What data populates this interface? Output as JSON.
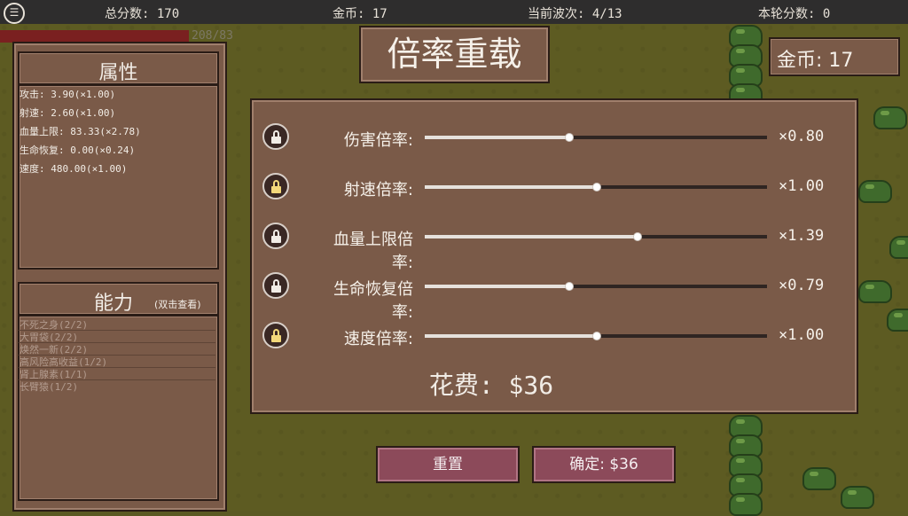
{
  "topbar": {
    "menu_icon": "☰",
    "total_score": "总分数: 170",
    "coins": "金币: 17",
    "wave": "当前波次: 4/13",
    "round_score": "本轮分数: 0"
  },
  "player": {
    "hp_text": "208/83",
    "hp_fraction": 1.0
  },
  "attributes": {
    "title": "属性",
    "lines": [
      "攻击: 3.90(×1.00)",
      "射速: 2.60(×1.00)",
      "血量上限: 83.33(×2.78)",
      "生命恢复: 0.00(×0.24)",
      "速度: 480.00(×1.00)"
    ]
  },
  "abilities": {
    "title": "能力",
    "hint": "(双击查看)",
    "items": [
      "不死之身(2/2)",
      "大胃袋(2/2)",
      "焕然一新(2/2)",
      "高风险高收益(1/2)",
      "肾上腺素(1/1)",
      "长臂猿(1/2)"
    ]
  },
  "header": {
    "title": "倍率重载"
  },
  "coin_box": {
    "label": "金币: 17"
  },
  "multipliers": [
    {
      "label": "伤害倍率:",
      "value": "×0.80",
      "level": 0.42,
      "locked": true,
      "lock_color": "white"
    },
    {
      "label": "射速倍率:",
      "value": "×1.00",
      "level": 0.5,
      "locked": true,
      "lock_color": "gold"
    },
    {
      "label": "血量上限倍率:",
      "value": "×1.39",
      "level": 0.62,
      "locked": false,
      "lock_color": "white"
    },
    {
      "label": "生命恢复倍率:",
      "value": "×0.79",
      "level": 0.42,
      "locked": true,
      "lock_color": "white"
    },
    {
      "label": "速度倍率:",
      "value": "×1.00",
      "level": 0.5,
      "locked": true,
      "lock_color": "gold"
    }
  ],
  "cost": {
    "label": "花费: $36"
  },
  "buttons": {
    "reset": "重置",
    "confirm": "确定: $36"
  }
}
